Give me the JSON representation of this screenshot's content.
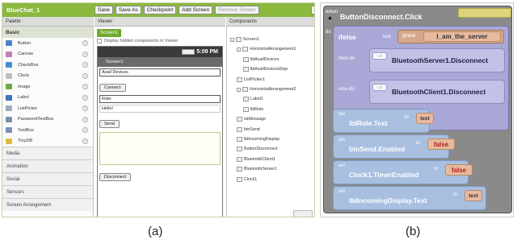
{
  "panel_a": {
    "project_name": "BlueChat_1",
    "toolbar": {
      "save": "Save",
      "save_as": "Save As",
      "checkpoint": "Checkpoint",
      "add_screen": "Add Screen",
      "remove_screen": "Remove Screen"
    },
    "palette": {
      "header": "Palette",
      "basic": "Basic",
      "items": [
        {
          "label": "Button",
          "icon": "button-icon",
          "color": "#4a7fc4"
        },
        {
          "label": "Canvas",
          "icon": "canvas-icon",
          "color": "#c37dbb"
        },
        {
          "label": "CheckBox",
          "icon": "checkbox-icon",
          "color": "#3f8fd2"
        },
        {
          "label": "Clock",
          "icon": "clock-icon",
          "color": "#c0c0c0"
        },
        {
          "label": "Image",
          "icon": "image-icon",
          "color": "#6fa84c"
        },
        {
          "label": "Label",
          "icon": "label-icon",
          "color": "#3c73c2"
        },
        {
          "label": "ListPicker",
          "icon": "list-picker-icon",
          "color": "#9fa8c4"
        },
        {
          "label": "PasswordTextBox",
          "icon": "password-icon",
          "color": "#7a8fa8"
        },
        {
          "label": "TextBox",
          "icon": "textbox-icon",
          "color": "#7b8fbf"
        },
        {
          "label": "TinyDB",
          "icon": "tinydb-icon",
          "color": "#e0bb48"
        }
      ],
      "categories": [
        "Media",
        "Animation",
        "Social",
        "Sensors",
        "Screen Arrangement"
      ]
    },
    "viewer": {
      "header": "Viewer",
      "screen_tab": "Screen1",
      "display_hidden": "Display hidden components in Viewer",
      "time": "5:09 PM",
      "title": "Screen1",
      "avail_devices": "Avail Devices",
      "connect": "Connect",
      "role": "Role:",
      "hello": "Hello!",
      "send": "Send",
      "disconnect": "Disconnect"
    },
    "components": {
      "header": "Components",
      "tree": [
        {
          "label": "Screen1",
          "toggle": "-"
        },
        {
          "label": "HorizontalArrangement1",
          "toggle": "-"
        },
        {
          "label": "lblAvailDevices",
          "toggle": ""
        },
        {
          "label": "lblAvailDevicesDisp",
          "toggle": ""
        },
        {
          "label": "ListPicker1",
          "toggle": ""
        },
        {
          "label": "HorizontalArrangement2",
          "toggle": "-"
        },
        {
          "label": "Label1",
          "toggle": ""
        },
        {
          "label": "lblRole",
          "toggle": ""
        },
        {
          "label": "txtMessage",
          "toggle": ""
        },
        {
          "label": "btnSend",
          "toggle": ""
        },
        {
          "label": "lblIncomingDisplay",
          "toggle": ""
        },
        {
          "label": "ButtonDisconnect",
          "toggle": ""
        },
        {
          "label": "BluetoothClient1",
          "toggle": ""
        },
        {
          "label": "BluetoothServer1",
          "toggle": ""
        },
        {
          "label": "Clock1",
          "toggle": ""
        }
      ]
    }
  },
  "panel_b": {
    "when": "when",
    "event": "ButtonDisconnect.Click",
    "do": "do",
    "ifelse": "ifelse",
    "test": "test",
    "global": "global",
    "global_var": "I_am_the_server",
    "then_do": "then-do",
    "else_do": "else-do",
    "call": "call",
    "call_then": "BluetoothServer1.Disconnect",
    "call_else": "BluetoothClient1.Disconnect",
    "set": "set",
    "to": "to",
    "text": "text",
    "sets": [
      {
        "prop": "lblRole.Text",
        "value": "text"
      },
      {
        "prop": "btnSend.Enabled",
        "value": "false"
      },
      {
        "prop": "Clock1.TimerEnabled",
        "value": "false"
      },
      {
        "prop": "lblIncomingDisplay.Text",
        "value": "text"
      }
    ]
  },
  "captions": {
    "a": "(a)",
    "b": "(b)"
  }
}
